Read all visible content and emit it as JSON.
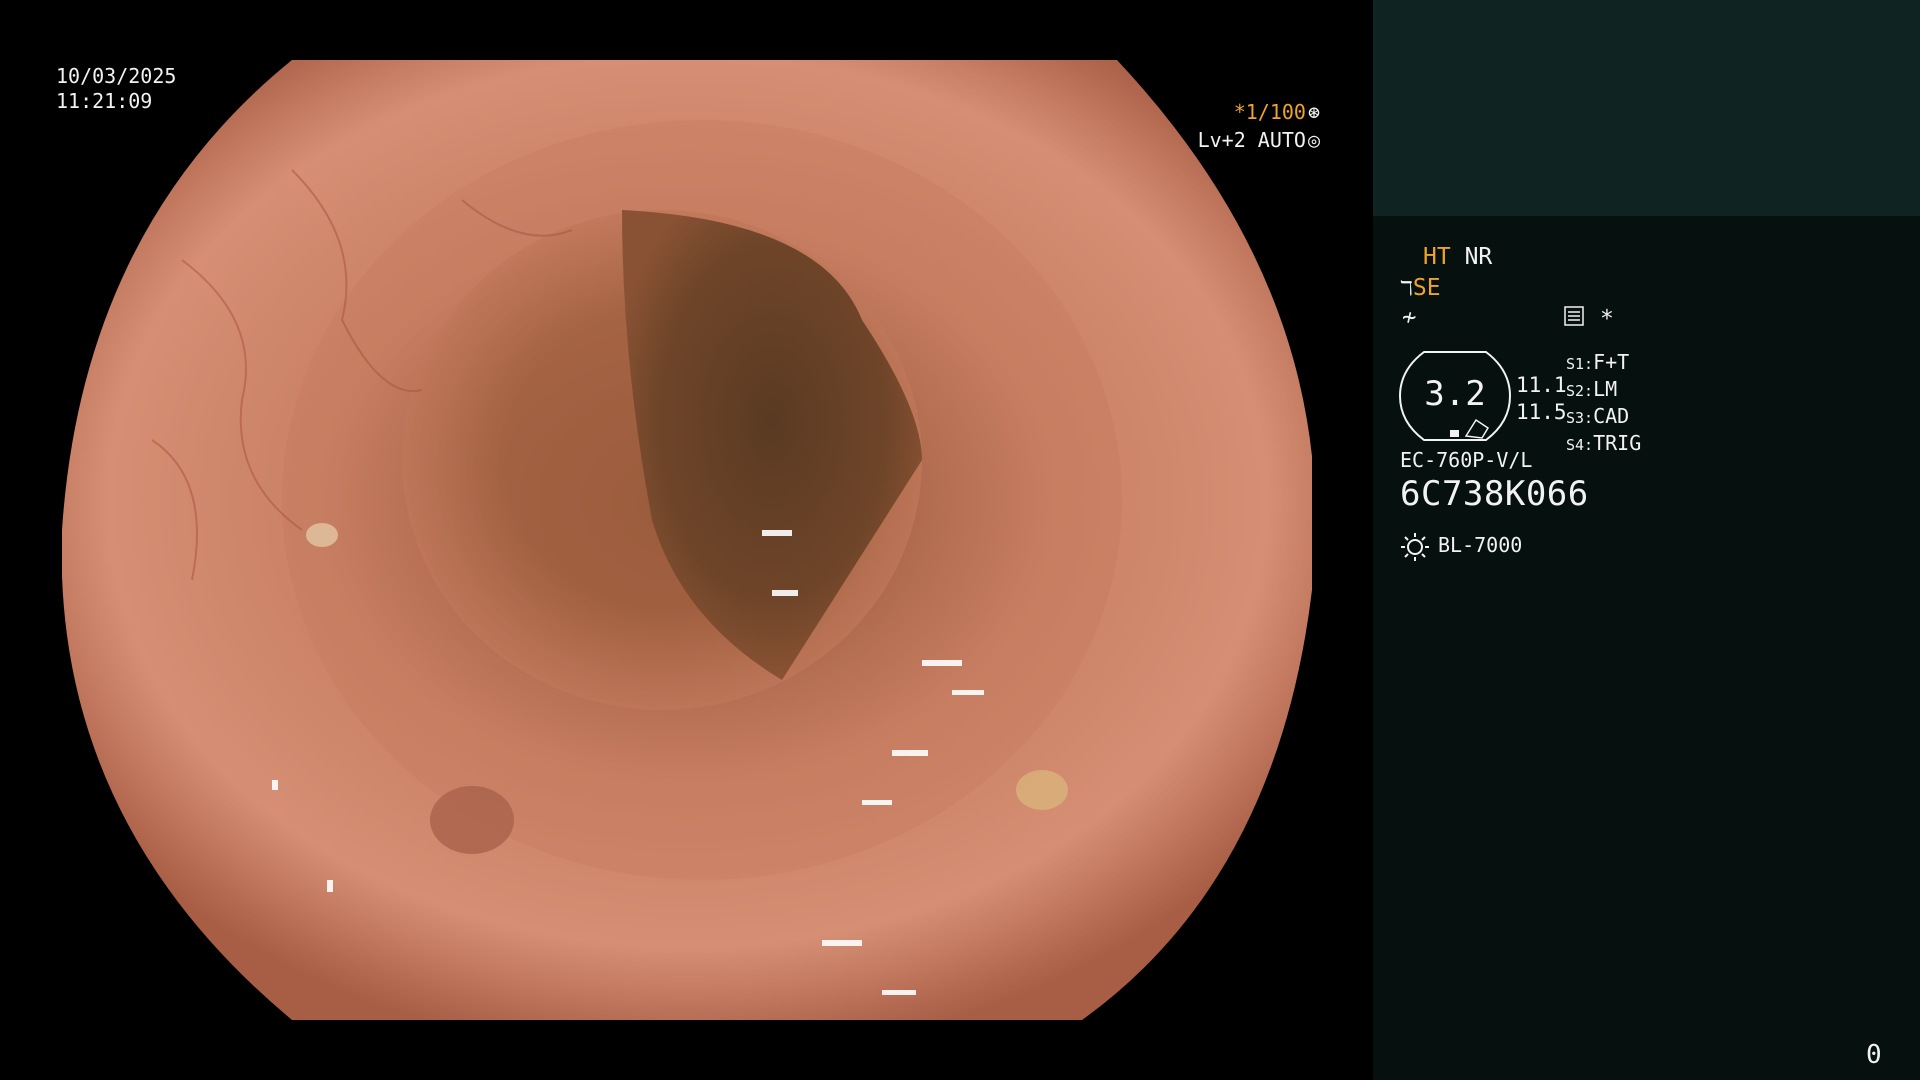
{
  "datetime": {
    "date": "10/03/2025",
    "time": "11:21:09"
  },
  "shutter": {
    "speed": "*1/100",
    "level": "Lv+2 AUTO"
  },
  "modes": {
    "ht": "HT",
    "nr": "NR",
    "se": "SE",
    "asterisk": "*"
  },
  "gauge": {
    "value": "3.2"
  },
  "readouts": [
    "11.1",
    "11.5"
  ],
  "switches": [
    {
      "label": "S1:",
      "value": "F+T"
    },
    {
      "label": "S2:",
      "value": "LM"
    },
    {
      "label": "S3:",
      "value": "CAD"
    },
    {
      "label": "S4:",
      "value": "TRIG"
    }
  ],
  "scope": {
    "model": "EC-760P-V/L",
    "serial": "6C738K066"
  },
  "light_source": {
    "label": "BL-7000"
  },
  "counter": "0",
  "colors": {
    "accent": "#f0a22a",
    "panel": "#06110f",
    "panel_top": "#0f2422"
  }
}
